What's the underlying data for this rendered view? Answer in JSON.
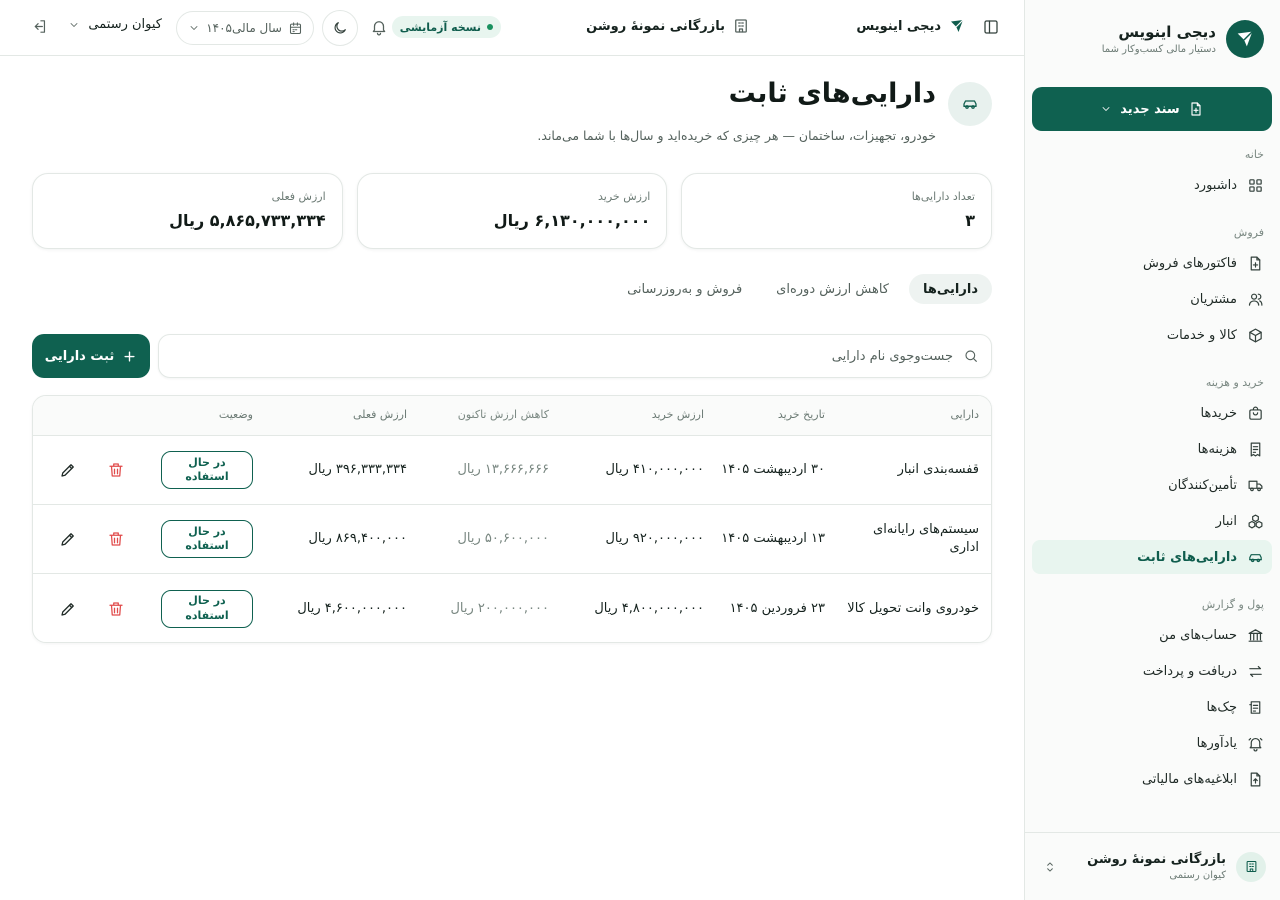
{
  "brand": {
    "name": "دیجی اینویس",
    "tagline": "دستیار مالی کسب‌وکار شما"
  },
  "sidebar": {
    "new_doc_label": "سند جدید",
    "sections": {
      "home": "خانه",
      "sales": "فروش",
      "purchase": "خرید و هزینه",
      "money": "پول و گزارش"
    },
    "items": {
      "dashboard": "داشبورد",
      "sales_invoices": "فاکتورهای فروش",
      "customers": "مشتریان",
      "products": "کالا و خدمات",
      "purchases": "خریدها",
      "expenses": "هزینه‌ها",
      "suppliers": "تأمین‌کنندگان",
      "warehouse": "انبار",
      "fixed_assets": "دارایی‌های ثابت",
      "accounts": "حساب‌های من",
      "receive_pay": "دریافت و پرداخت",
      "cheques": "چک‌ها",
      "reminders": "یادآورها",
      "tax_notices": "ابلاغیه‌های مالیاتی"
    },
    "footer": {
      "business": "بازرگانی نمونهٔ روشن",
      "user": "کیوان رستمی"
    }
  },
  "header": {
    "app_name": "دیجی اینویس",
    "business": "بازرگانی نمونهٔ روشن",
    "trial_badge": "نسخه آزمایشی",
    "fiscal_year": "سال مالی۱۴۰۵",
    "user": "کیوان رستمی"
  },
  "page": {
    "title": "دارایی‌های ثابت",
    "subtitle": "خودرو، تجهیزات، ساختمان — هر چیزی که خریده‌اید و سال‌ها با شما می‌ماند."
  },
  "stats": [
    {
      "label": "تعداد دارایی‌ها",
      "value": "۳"
    },
    {
      "label": "ارزش خرید",
      "value": "۶,۱۳۰,۰۰۰,۰۰۰ ریال"
    },
    {
      "label": "ارزش فعلی",
      "value": "۵,۸۶۵,۷۳۳,۳۳۴ ریال"
    }
  ],
  "tabs": [
    "دارایی‌ها",
    "کاهش ارزش دوره‌ای",
    "فروش و به‌روزرسانی"
  ],
  "search": {
    "placeholder": "جست‌وجوی نام دارایی"
  },
  "add_button": "ثبت دارایی",
  "table": {
    "headers": {
      "asset": "دارایی",
      "purchase_date": "تاریخ خرید",
      "purchase_value": "ارزش خرید",
      "depreciation": "کاهش ارزش تاکنون",
      "current_value": "ارزش فعلی",
      "status": "وضعیت"
    },
    "rows": [
      {
        "asset": "قفسه‌بندی انبار",
        "date": "۳۰ اردیبهشت ۱۴۰۵",
        "purchase": "۴۱۰,۰۰۰,۰۰۰ ریال",
        "depreciation": "۱۳,۶۶۶,۶۶۶ ریال",
        "current": "۳۹۶,۳۳۳,۳۳۴ ریال",
        "status": "در حال استفاده"
      },
      {
        "asset": "سیستم‌های رایانه‌ای اداری",
        "date": "۱۳ اردیبهشت ۱۴۰۵",
        "purchase": "۹۲۰,۰۰۰,۰۰۰ ریال",
        "depreciation": "۵۰,۶۰۰,۰۰۰ ریال",
        "current": "۸۶۹,۴۰۰,۰۰۰ ریال",
        "status": "در حال استفاده"
      },
      {
        "asset": "خودروی وانت تحویل کالا",
        "date": "۲۳ فروردین ۱۴۰۵",
        "purchase": "۴,۸۰۰,۰۰۰,۰۰۰ ریال",
        "depreciation": "۲۰۰,۰۰۰,۰۰۰ ریال",
        "current": "۴,۶۰۰,۰۰۰,۰۰۰ ریال",
        "status": "در حال استفاده"
      }
    ]
  },
  "colors": {
    "primary": "#0f6150",
    "active_bg": "#e8f5ef",
    "danger": "#e14b4b"
  }
}
